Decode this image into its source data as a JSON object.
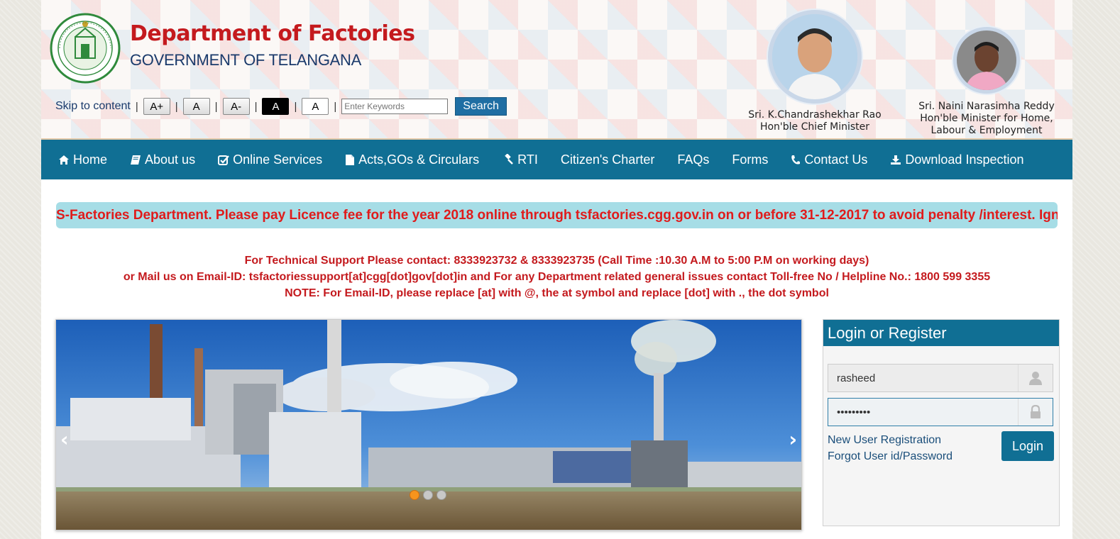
{
  "header": {
    "title": "Department of Factories",
    "subtitle": "GOVERNMENT OF TELANGANA",
    "emblem_icon": "telangana-emblem-icon"
  },
  "toolbar": {
    "skip_link": "Skip to content",
    "separator": "|",
    "font_increase": "A+",
    "font_normal": "A",
    "font_decrease": "A-",
    "contrast_dark": "A",
    "contrast_light": "A",
    "search_placeholder": "Enter Keywords",
    "search_button": "Search"
  },
  "leaders": [
    {
      "name": "Sri. K.Chandrashekhar Rao",
      "role": "Hon'ble Chief Minister"
    },
    {
      "name": "Sri. Naini Narasimha Reddy",
      "role": "Hon'ble Minister for Home, Labour & Employment"
    }
  ],
  "nav": {
    "items": [
      {
        "label": "Home",
        "icon": "home-icon"
      },
      {
        "label": "About us",
        "icon": "book-icon"
      },
      {
        "label": "Online Services",
        "icon": "check-square-icon"
      },
      {
        "label": "Acts,GOs & Circulars",
        "icon": "file-icon"
      },
      {
        "label": "RTI",
        "icon": "gavel-icon"
      },
      {
        "label": "Citizen's Charter",
        "icon": ""
      },
      {
        "label": "FAQs",
        "icon": ""
      },
      {
        "label": "Forms",
        "icon": ""
      },
      {
        "label": "Contact Us",
        "icon": "phone-icon"
      },
      {
        "label": "Download Inspection",
        "icon": "download-icon"
      }
    ]
  },
  "marquee": {
    "text": "S-Factories Department. Please pay Licence fee for the year 2018 online through tsfactories.cgg.gov.in on or before 31-12-2017 to avoid penalty /interest. Ignore"
  },
  "support": {
    "line1": "For Technical Support Please contact: 8333923732 & 8333923735 (Call Time :10.30 A.M to 5:00 P.M on working days)",
    "line2": "or Mail us on Email-ID: tsfactoriessupport[at]cgg[dot]gov[dot]in and For any Department related general issues contact Toll-free No / Helpline No.: 1800 599 3355",
    "line3": "NOTE: For Email-ID, please replace [at] with @, the at symbol and replace [dot] with ., the dot symbol"
  },
  "slider": {
    "prev": "‹",
    "next": "›",
    "slide_count": 3,
    "active_slide": 1
  },
  "login": {
    "title": "Login or Register",
    "username_value": "rasheed",
    "password_value": "•••••••••",
    "new_user": "New User Registration",
    "forgot": "Forgot User id/Password",
    "button": "Login"
  },
  "colors": {
    "nav_bg": "#106f94",
    "title_red": "#c41a1e",
    "marquee_bg": "#a6dde6",
    "active_dot": "#f7941d"
  }
}
